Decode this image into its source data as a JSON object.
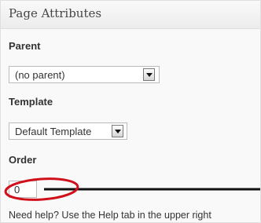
{
  "panel": {
    "title": "Page Attributes"
  },
  "parent": {
    "label": "Parent",
    "selected": "(no parent)"
  },
  "template": {
    "label": "Template",
    "selected": "Default Template"
  },
  "order": {
    "label": "Order",
    "value": "0"
  },
  "help": {
    "text": "Need help? Use the Help tab in the upper right"
  },
  "colors": {
    "annotation": "#d0101b",
    "pointer_line": "#111111"
  }
}
